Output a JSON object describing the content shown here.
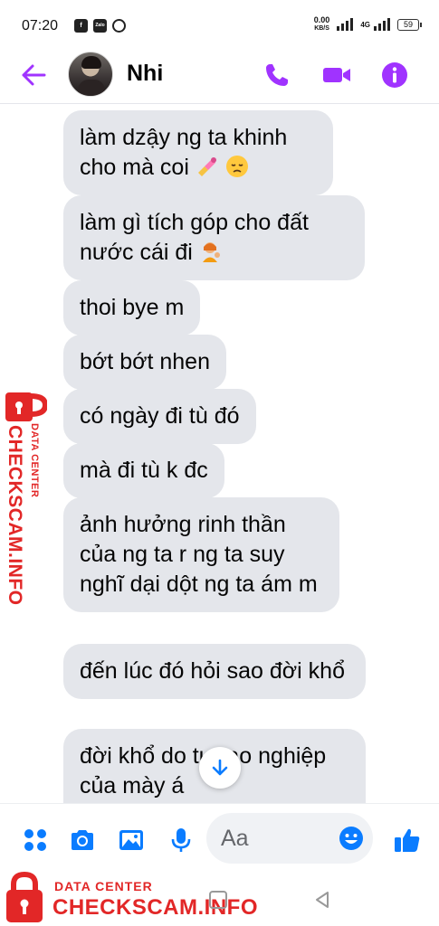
{
  "status_bar": {
    "time": "07:20",
    "speed_value": "0.00",
    "speed_unit": "KB/S",
    "network": "4G",
    "battery": "59",
    "app_icons": [
      "facebook-icon",
      "zalo-icon",
      "messenger-icon"
    ]
  },
  "header": {
    "contact_name": "Nhi",
    "accent_color": "#a033ff"
  },
  "messages": [
    {
      "text": "làm dzậy ng ta khinh cho mà coi",
      "emojis": [
        "nail-polish-icon",
        "disappointed-face-icon"
      ]
    },
    {
      "text": "làm gì tích góp cho đất nước cái đi",
      "emojis": [
        "person-tipping-hand-icon"
      ]
    },
    {
      "text": "thoi bye m"
    },
    {
      "text": "bớt bớt nhen"
    },
    {
      "text": "có ngày đi tù đó"
    },
    {
      "text": "mà đi tù k đc"
    },
    {
      "text": "ảnh hưởng rinh thần của ng ta r ng ta suy nghĩ dại dột ng ta ám m"
    },
    {
      "text": "đến lúc đó hỏi sao đời khổ"
    },
    {
      "text": "đời khổ do tự tạo nghiệp của mày á"
    }
  ],
  "composer": {
    "placeholder": "Aa",
    "accent_color": "#0a7cff"
  },
  "watermark": {
    "small": "DATA CENTER",
    "big": "CHECKSCAM.INFO",
    "color": "#e22727"
  }
}
